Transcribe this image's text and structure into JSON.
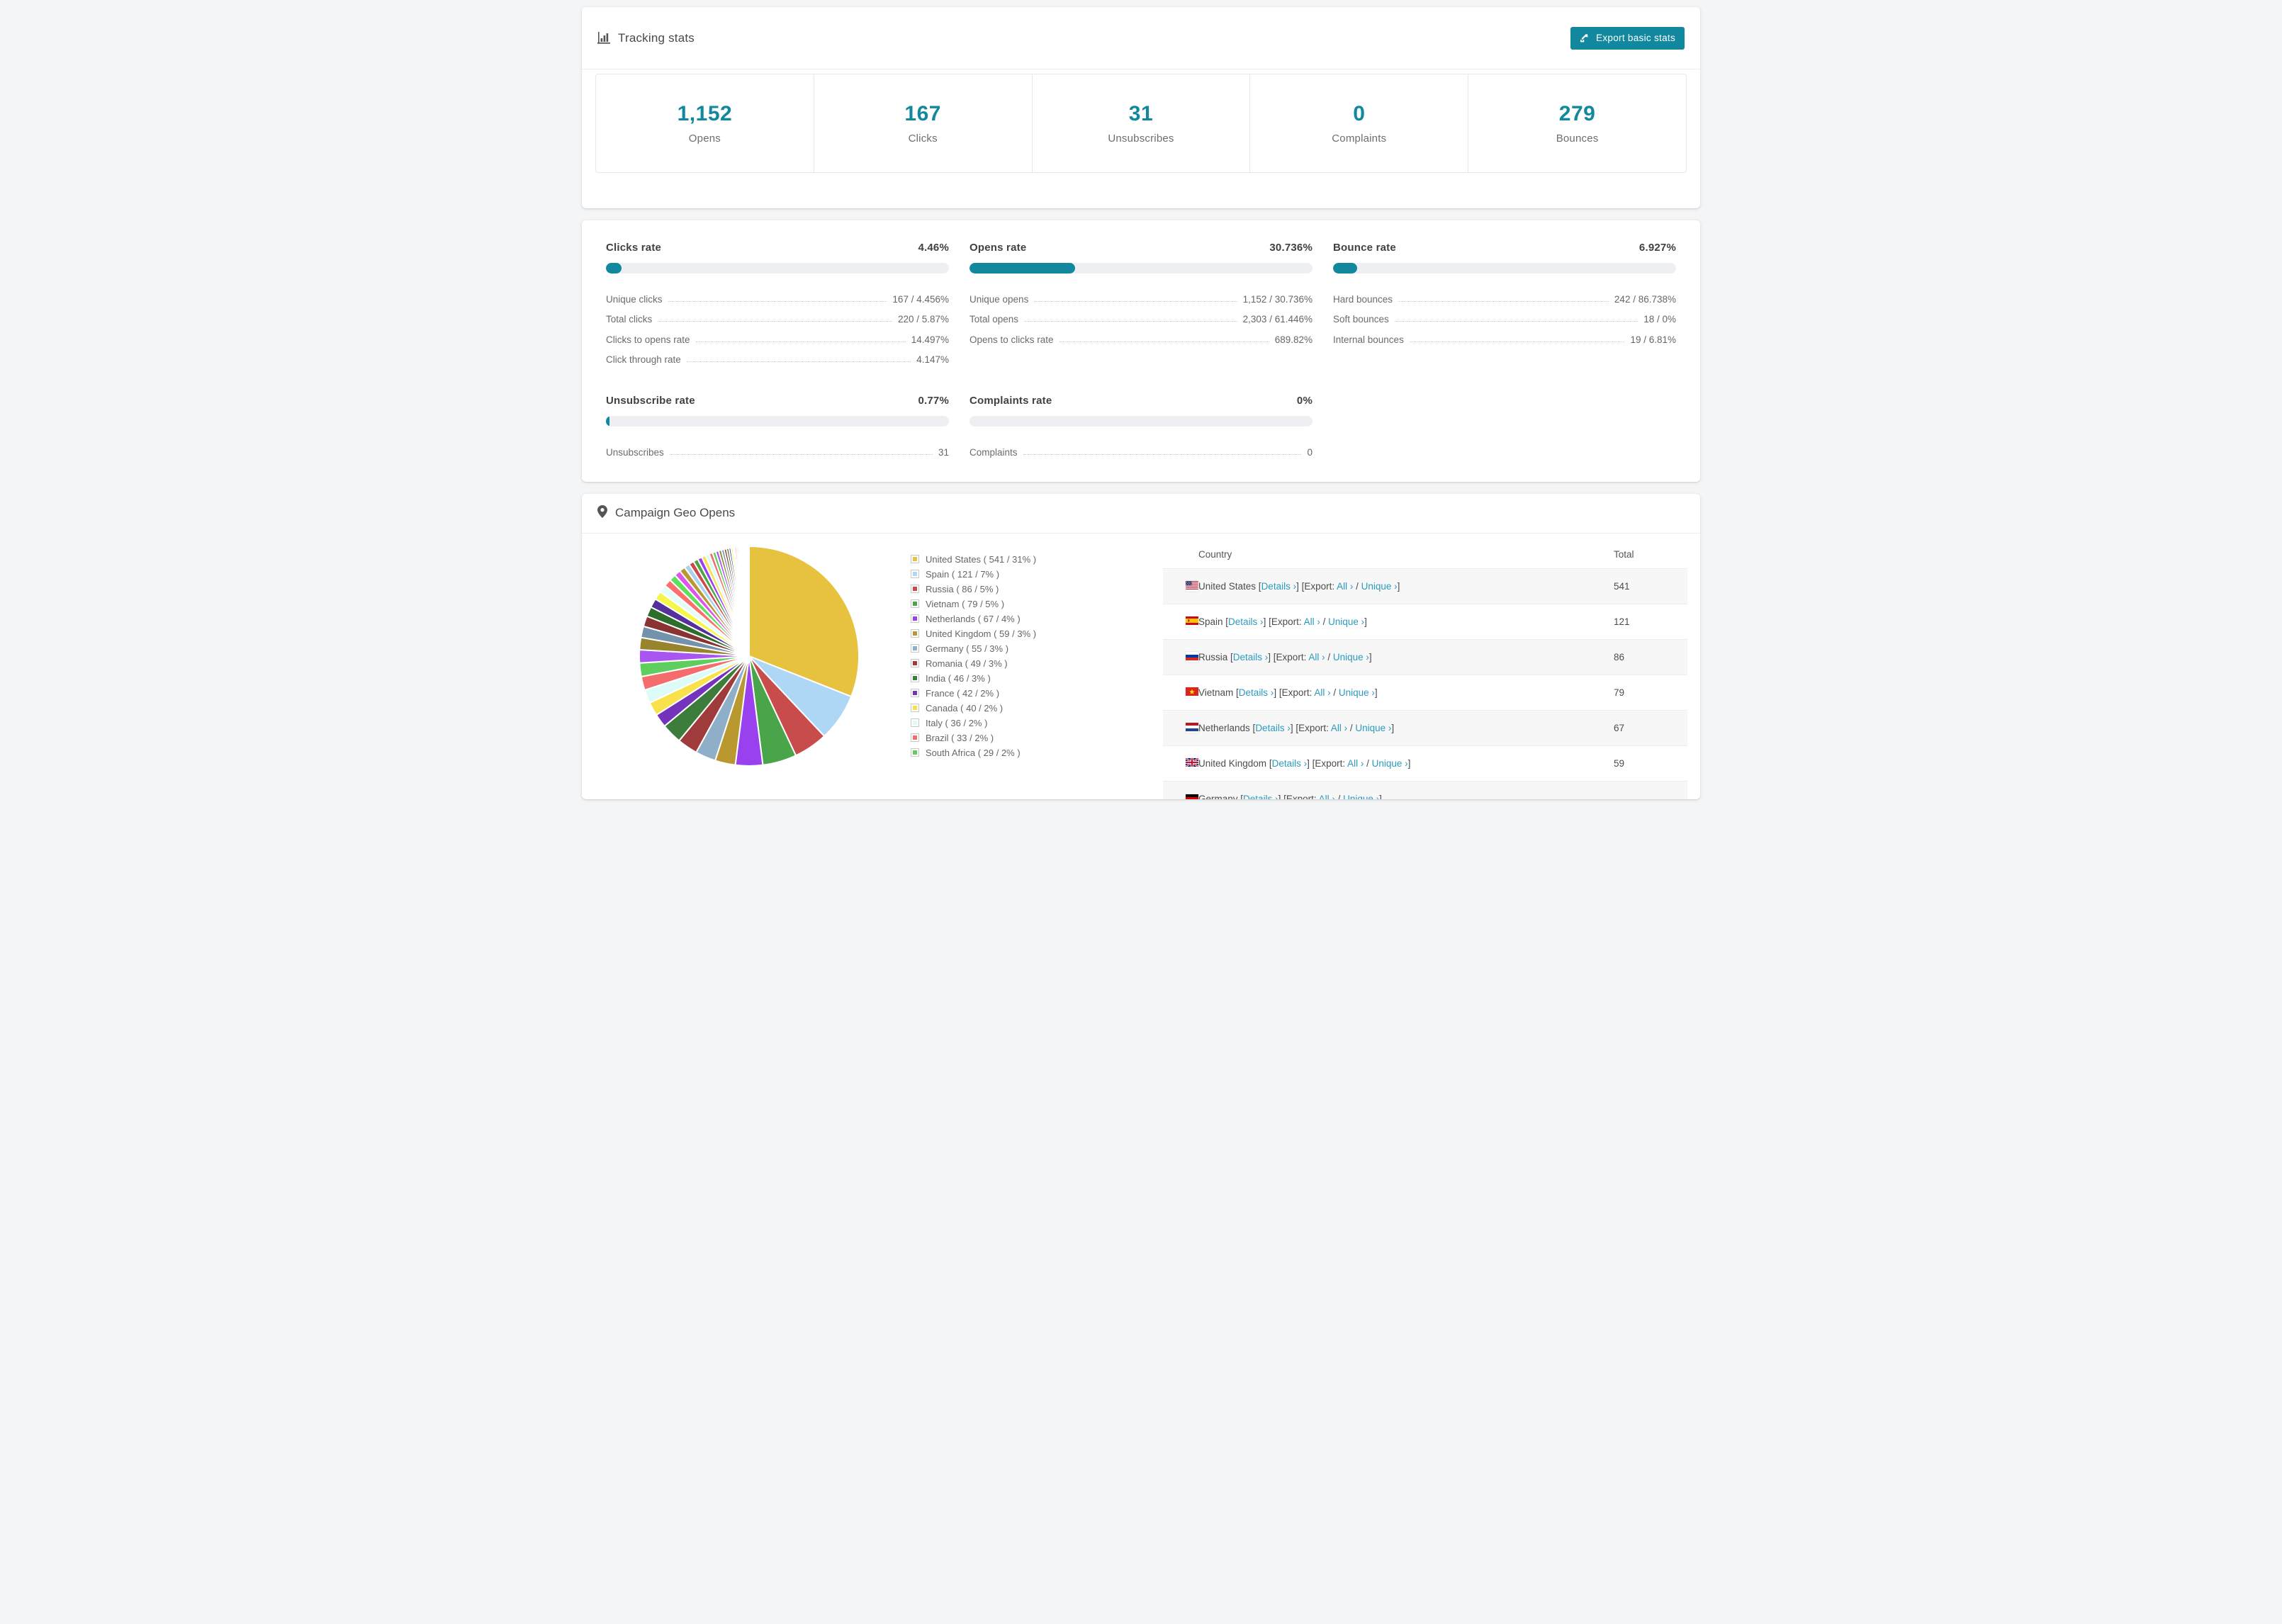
{
  "accent": "#12889e",
  "link_color": "#2b9bbd",
  "tracking": {
    "title": "Tracking stats",
    "export_button": "Export basic stats",
    "stats": [
      {
        "value": "1,152",
        "label": "Opens"
      },
      {
        "value": "167",
        "label": "Clicks"
      },
      {
        "value": "31",
        "label": "Unsubscribes"
      },
      {
        "value": "0",
        "label": "Complaints"
      },
      {
        "value": "279",
        "label": "Bounces"
      }
    ]
  },
  "rates": [
    {
      "title": "Clicks rate",
      "value": "4.46%",
      "percent": 4.46,
      "rows": [
        [
          "Unique clicks",
          "167 / 4.456%"
        ],
        [
          "Total clicks",
          "220 / 5.87%"
        ],
        [
          "Clicks to opens rate",
          "14.497%"
        ],
        [
          "Click through rate",
          "4.147%"
        ]
      ]
    },
    {
      "title": "Opens rate",
      "value": "30.736%",
      "percent": 30.736,
      "rows": [
        [
          "Unique opens",
          "1,152 / 30.736%"
        ],
        [
          "Total opens",
          "2,303 / 61.446%"
        ],
        [
          "Opens to clicks rate",
          "689.82%"
        ]
      ]
    },
    {
      "title": "Bounce rate",
      "value": "6.927%",
      "percent": 6.927,
      "rows": [
        [
          "Hard bounces",
          "242 / 86.738%"
        ],
        [
          "Soft bounces",
          "18 / 0%"
        ],
        [
          "Internal bounces",
          "19 / 6.81%"
        ]
      ]
    },
    {
      "title": "Unsubscribe rate",
      "value": "0.77%",
      "percent": 0.77,
      "rows": [
        [
          "Unsubscribes",
          "31"
        ]
      ]
    },
    {
      "title": "Complaints rate",
      "value": "0%",
      "percent": 0,
      "rows": [
        [
          "Complaints",
          "0"
        ]
      ]
    }
  ],
  "geo": {
    "title": "Campaign Geo Opens",
    "table": {
      "headers": {
        "country": "Country",
        "total": "Total"
      },
      "links": {
        "details": "Details ›",
        "export_prefix": "Export:",
        "all": "All ›",
        "unique": "Unique ›"
      },
      "rows": [
        {
          "country": "United States",
          "flag": "us",
          "total": "541"
        },
        {
          "country": "Spain",
          "flag": "es",
          "total": "121"
        },
        {
          "country": "Russia",
          "flag": "ru",
          "total": "86"
        },
        {
          "country": "Vietnam",
          "flag": "vn",
          "total": "79"
        },
        {
          "country": "Netherlands",
          "flag": "nl",
          "total": "67"
        },
        {
          "country": "United Kingdom",
          "flag": "gb",
          "total": "59"
        },
        {
          "country": "Germany",
          "flag": "de",
          "total": ""
        }
      ]
    }
  },
  "chart_data": {
    "type": "pie",
    "title": "Campaign Geo Opens",
    "legend_position": "right",
    "start_angle_deg": -90,
    "direction": "clockwise",
    "slices": [
      {
        "label": "United States",
        "value": 541,
        "percent": 31,
        "color": "#e6c23f"
      },
      {
        "label": "Spain",
        "value": 121,
        "percent": 7,
        "color": "#aed6f5"
      },
      {
        "label": "Russia",
        "value": 86,
        "percent": 5,
        "color": "#c94c4c"
      },
      {
        "label": "Vietnam",
        "value": 79,
        "percent": 5,
        "color": "#4aa44a"
      },
      {
        "label": "Netherlands",
        "value": 67,
        "percent": 4,
        "color": "#9a41ef"
      },
      {
        "label": "United Kingdom",
        "value": 59,
        "percent": 3,
        "color": "#b8982f"
      },
      {
        "label": "Germany",
        "value": 55,
        "percent": 3,
        "color": "#8fafc9"
      },
      {
        "label": "Romania",
        "value": 49,
        "percent": 3,
        "color": "#a03b3b"
      },
      {
        "label": "India",
        "value": 46,
        "percent": 3,
        "color": "#3c7d3c"
      },
      {
        "label": "France",
        "value": 42,
        "percent": 2,
        "color": "#7433bd"
      },
      {
        "label": "Canada",
        "value": 40,
        "percent": 2,
        "color": "#f8e14b"
      },
      {
        "label": "Italy",
        "value": 36,
        "percent": 2,
        "color": "#defcf7"
      },
      {
        "label": "Brazil",
        "value": 33,
        "percent": 2,
        "color": "#f56c6c"
      },
      {
        "label": "South Africa",
        "value": 29,
        "percent": 2,
        "color": "#5ecf5e"
      }
    ],
    "others": {
      "percent": 26,
      "approx_slice_count": 40
    },
    "legend_format": "{label} ( {value} / {percent}% )"
  }
}
